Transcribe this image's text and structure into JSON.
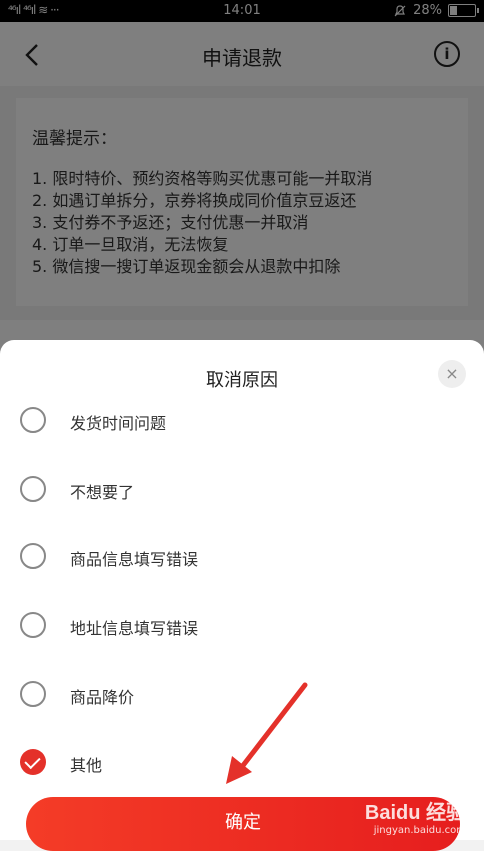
{
  "status_bar": {
    "signal": "⁴⁶ıl ⁴⁶ıl ≋ ···",
    "time": "14:01",
    "mute_icon": "bell-off-icon",
    "battery": "28%",
    "battery_level": 0.28
  },
  "header": {
    "title": "申请退款"
  },
  "notice": {
    "heading": "温馨提示：",
    "lines": [
      "1. 限时特价、预约资格等购买优惠可能一并取消",
      "2. 如遇订单拆分，京券将换成同价值京豆返还",
      "3. 支付券不予返还；支付优惠一并取消",
      "4. 订单一旦取消，无法恢复",
      "5. 微信搜一搜订单返现金额会从退款中扣除"
    ]
  },
  "sheet": {
    "title": "取消原因",
    "close_icon": "×",
    "options": [
      {
        "label": "发货时间问题",
        "checked": false
      },
      {
        "label": "不想要了",
        "checked": false
      },
      {
        "label": "商品信息填写错误",
        "checked": false
      },
      {
        "label": "地址信息填写错误",
        "checked": false
      },
      {
        "label": "商品降价",
        "checked": false
      },
      {
        "label": "其他",
        "checked": true
      }
    ],
    "confirm_label": "确定"
  },
  "watermark": {
    "brand": "Baidu 经验",
    "url": "jingyan.baidu.com"
  },
  "colors": {
    "accent": "#e4312a"
  }
}
